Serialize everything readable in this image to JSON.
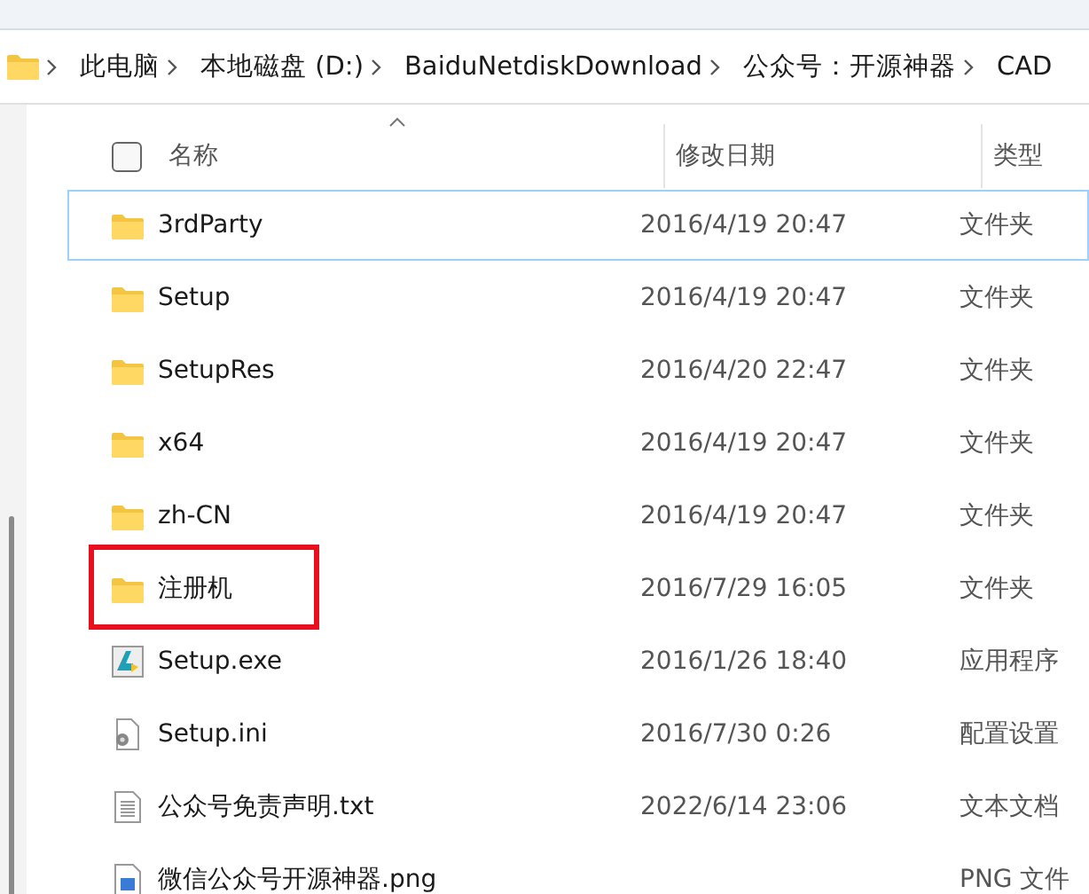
{
  "breadcrumb": [
    "此电脑",
    "本地磁盘 (D:)",
    "BaiduNetdiskDownload",
    "公众号：开源神器",
    "CAD"
  ],
  "columns": [
    {
      "label": "名称",
      "sorted": true
    },
    {
      "label": "修改日期",
      "sorted": false
    },
    {
      "label": "类型",
      "sorted": false
    }
  ],
  "select_all": {
    "checked": false
  },
  "rows": [
    {
      "kind": "folder",
      "name": "3rdParty",
      "date": "2016/4/19 20:47",
      "type": "文件夹",
      "focused": true,
      "highlighted": false
    },
    {
      "kind": "folder",
      "name": "Setup",
      "date": "2016/4/19 20:47",
      "type": "文件夹",
      "focused": false,
      "highlighted": false
    },
    {
      "kind": "folder",
      "name": "SetupRes",
      "date": "2016/4/20 22:47",
      "type": "文件夹",
      "focused": false,
      "highlighted": false
    },
    {
      "kind": "folder",
      "name": "x64",
      "date": "2016/4/19 20:47",
      "type": "文件夹",
      "focused": false,
      "highlighted": false
    },
    {
      "kind": "folder",
      "name": "zh-CN",
      "date": "2016/4/19 20:47",
      "type": "文件夹",
      "focused": false,
      "highlighted": false
    },
    {
      "kind": "folder",
      "name": "注册机",
      "date": "2016/7/29 16:05",
      "type": "文件夹",
      "focused": false,
      "highlighted": true
    },
    {
      "kind": "exe",
      "name": "Setup.exe",
      "date": "2016/1/26 18:40",
      "type": "应用程序",
      "focused": false,
      "highlighted": false
    },
    {
      "kind": "ini",
      "name": "Setup.ini",
      "date": "2016/7/30 0:26",
      "type": "配置设置",
      "focused": false,
      "highlighted": false
    },
    {
      "kind": "txt",
      "name": "公众号免责声明.txt",
      "date": "2022/6/14 23:06",
      "type": "文本文档",
      "focused": false,
      "highlighted": false
    },
    {
      "kind": "png",
      "name": "微信公众号开源神器.png",
      "type": "PNG 文件",
      "focused": false,
      "highlighted": false
    }
  ]
}
